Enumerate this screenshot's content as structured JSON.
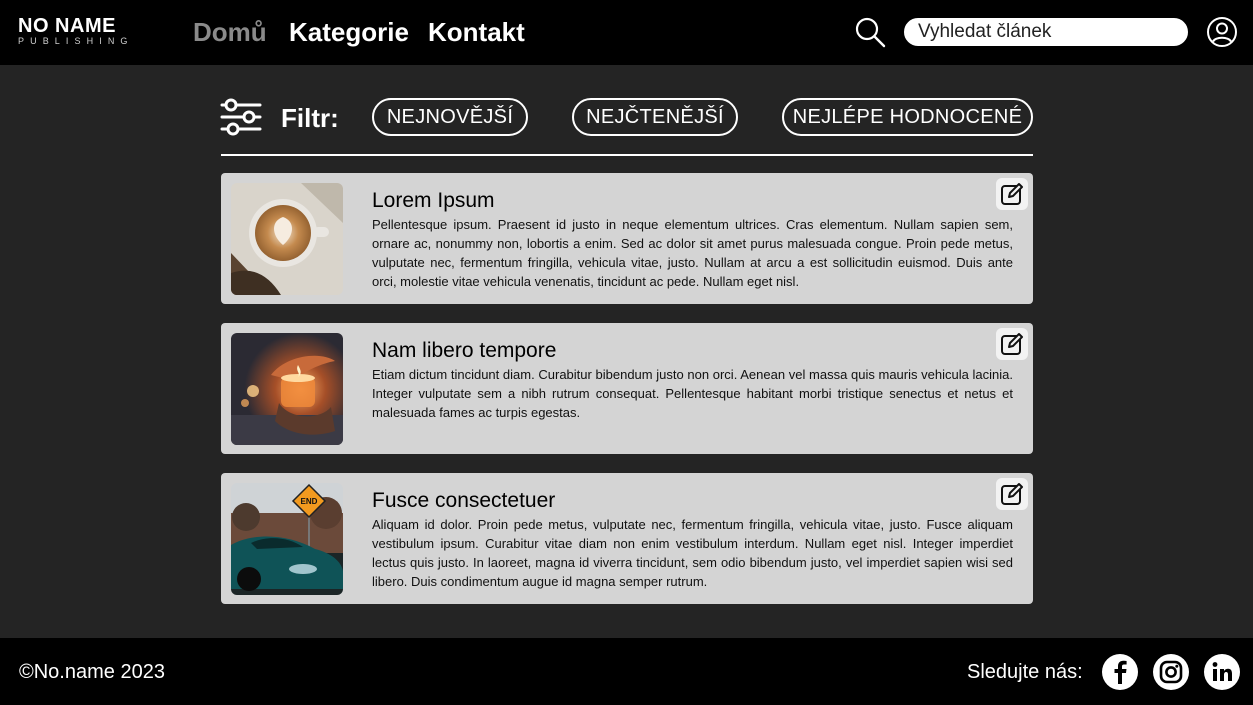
{
  "logo": {
    "main": "NO NAME",
    "sub": "PUBLISHING"
  },
  "nav": {
    "home": "Domů",
    "categories": "Kategorie",
    "contact": "Kontakt"
  },
  "search": {
    "placeholder": "Vyhledat článek",
    "value": ""
  },
  "filter": {
    "label": "Filtr:",
    "options": [
      "NEJNOVĚJŠÍ",
      "NEJČTENĚJŠÍ",
      "NEJLÉPE HODNOCENÉ"
    ]
  },
  "articles": [
    {
      "title": "Lorem Ipsum",
      "text": "Pellentesque ipsum. Praesent id justo in neque elementum ultrices. Cras elementum. Nullam sapien sem, ornare ac, nonummy non, lobortis a enim. Sed ac dolor sit amet purus malesuada congue. Proin pede metus, vulputate nec, fermentum fringilla, vehicula vitae, justo. Nullam at arcu a est sollicitudin euismod. Duis ante orci, molestie vitae vehicula venenatis, tincidunt ac pede. Nullam eget nisl.",
      "image": "latte-coffee-image"
    },
    {
      "title": "Nam libero tempore",
      "text": "Etiam dictum tincidunt diam. Curabitur bibendum justo non orci. Aenean vel massa quis mauris vehicula lacinia. Integer vulputate sem a nibh rutrum consequat. Pellentesque habitant morbi tristique senectus et netus et malesuada fames ac turpis egestas.",
      "image": "candle-hands-image"
    },
    {
      "title": "Fusce consectetuer",
      "text": "Aliquam id dolor. Proin pede metus, vulputate nec, fermentum fringilla, vehicula vitae, justo. Fusce aliquam vestibulum ipsum. Curabitur vitae diam non enim vestibulum interdum. Nullam eget nisl. Integer imperdiet lectus quis justo. In laoreet, magna id viverra tincidunt, sem odio bibendum justo, vel imperdiet sapien wisi sed libero. Duis condimentum augue id magna semper rutrum.",
      "image": "car-end-sign-image",
      "sign": "END"
    }
  ],
  "footer": {
    "copyright": "©No.name 2023",
    "follow": "Sledujte nás:",
    "social": [
      "facebook-icon",
      "instagram-icon",
      "linkedin-icon"
    ]
  },
  "colors": {
    "header_bg": "#000000",
    "page_bg": "#242424",
    "card_bg": "#d4d4d4",
    "nav_active": "#8a8a8a"
  }
}
